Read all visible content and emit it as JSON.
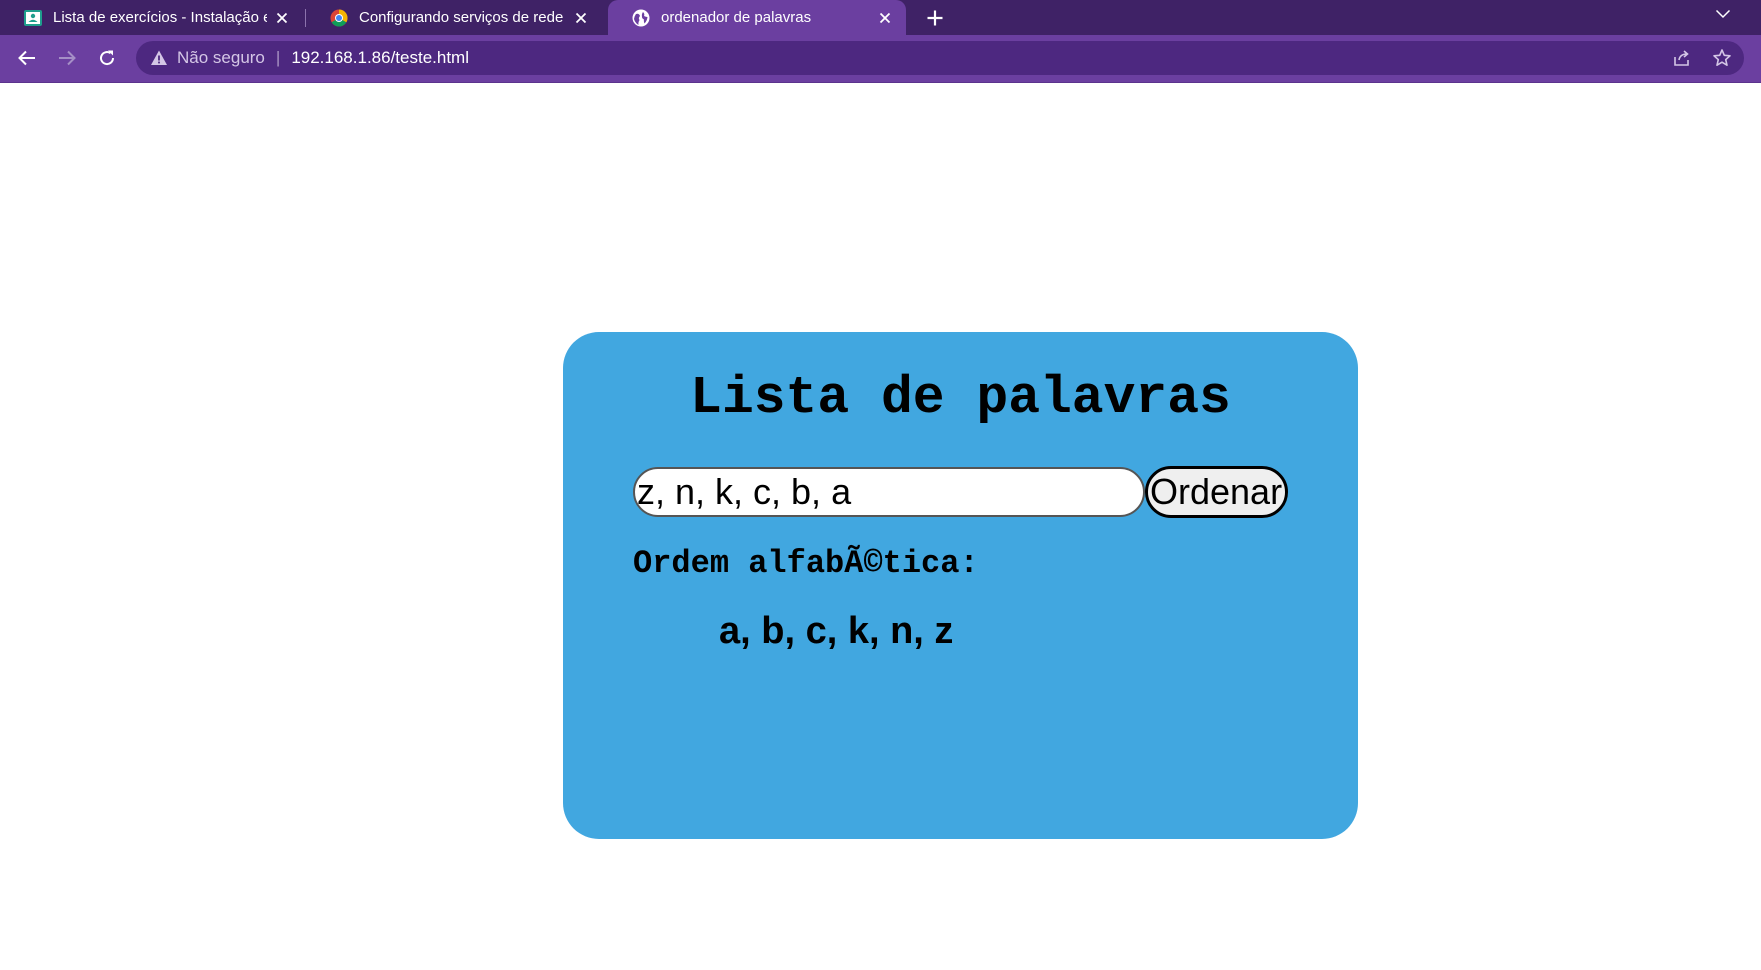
{
  "browser": {
    "tabs": [
      {
        "title": "Lista de exercícios - Instalação e c",
        "icon": "classroom-icon",
        "active": false
      },
      {
        "title": "Configurando serviços de rede",
        "icon": "chrome-icon",
        "active": false
      },
      {
        "title": "ordenador de palavras",
        "icon": "globe-icon",
        "active": true
      }
    ],
    "address_bar": {
      "security_label": "Não seguro",
      "separator": "|",
      "url": "192.168.1.86/teste.html"
    },
    "colors": {
      "tabstrip": "#3f2266",
      "toolbar": "#6b3fa0",
      "omnibox": "#4d2880"
    }
  },
  "page": {
    "title": "Lista de palavras",
    "input_value": "z, n, k, c, b, a",
    "button_label": "Ordenar",
    "result_label": "Ordem alfabÃ©tica:",
    "result_value": "a, b, c, k, n, z",
    "colors": {
      "card": "#41a7e0",
      "background": "#ffffff"
    }
  }
}
